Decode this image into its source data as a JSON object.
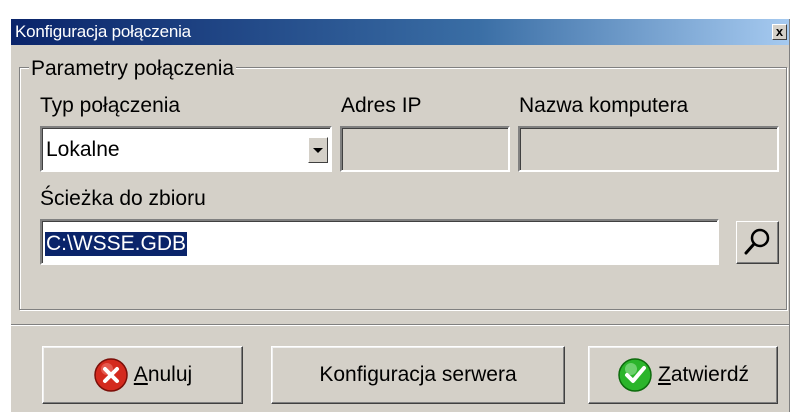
{
  "window": {
    "title": "Konfiguracja połączenia",
    "close_label": "x"
  },
  "group": {
    "legend": "Parametry połączenia",
    "connection_type": {
      "label": "Typ połączenia",
      "value": "Lokalne"
    },
    "ip_address": {
      "label": "Adres IP",
      "value": ""
    },
    "computer_name": {
      "label": "Nazwa komputera",
      "value": ""
    },
    "file_path": {
      "label": "Ścieżka do zbioru",
      "value": "C:\\WSSE.GDB"
    }
  },
  "buttons": {
    "cancel": {
      "mnemonic": "A",
      "rest": "nuluj",
      "icon": "red-x-icon"
    },
    "server_config": {
      "label": "Konfiguracja serwera"
    },
    "confirm": {
      "mnemonic": "Z",
      "rest": "atwierdź",
      "icon": "green-check-icon"
    }
  },
  "colors": {
    "title_start": "#0a246a",
    "title_end": "#a6caf0",
    "face": "#d4d0c8",
    "selection": "#0a246a"
  }
}
